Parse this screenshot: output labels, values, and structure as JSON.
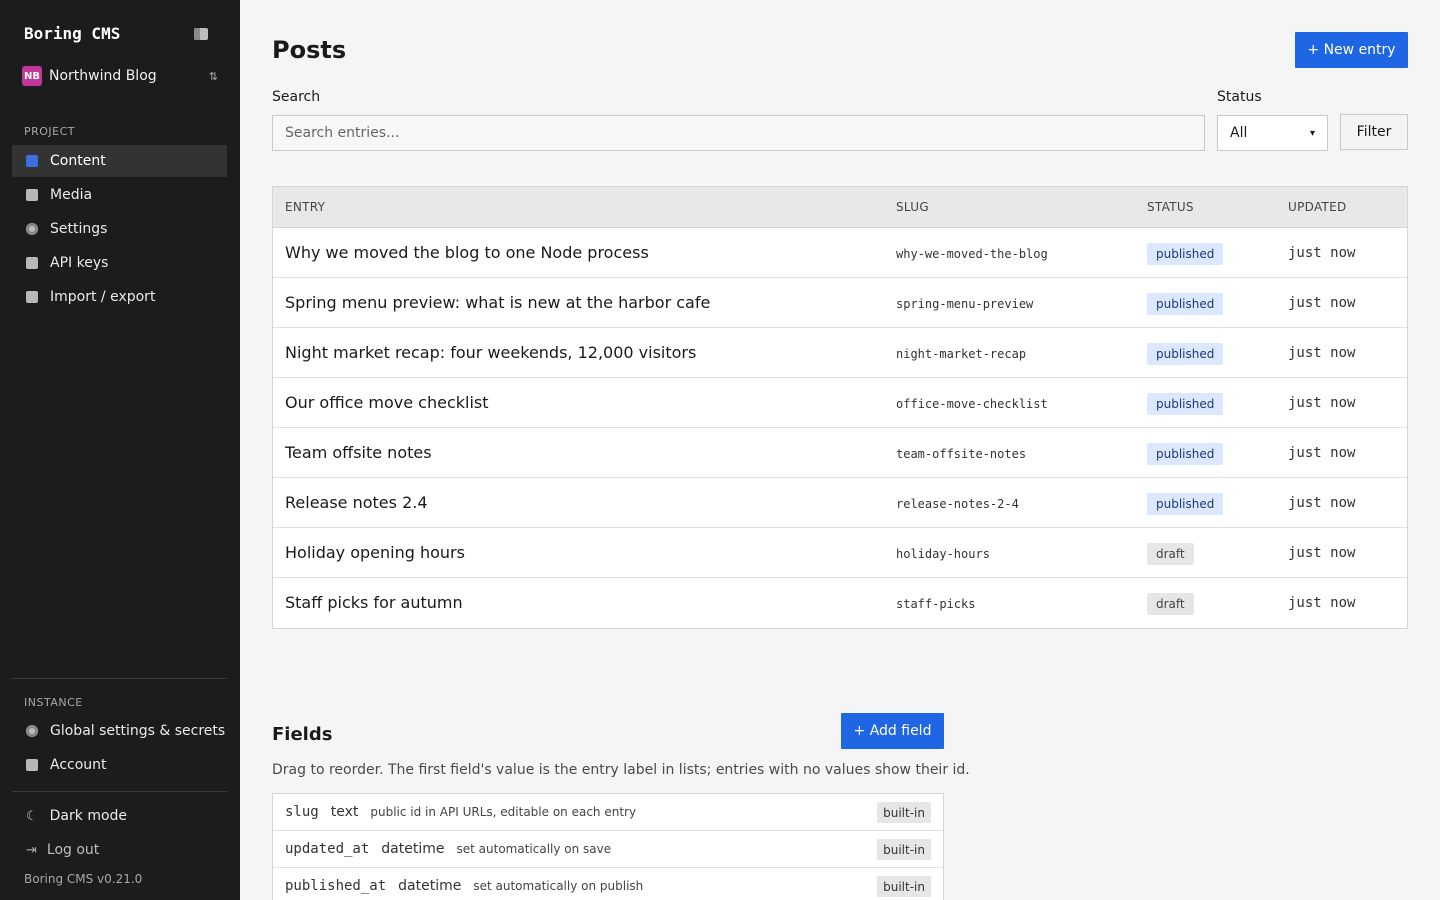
{
  "app": {
    "brand": "Boring CMS",
    "project_initials": "NB",
    "project_name": "Northwind Blog",
    "version": "Boring CMS v0.21.0"
  },
  "sidebar": {
    "project_label": "PROJECT",
    "project_items": [
      {
        "label": "Content",
        "icon": "content-icon",
        "active": true
      },
      {
        "label": "Media",
        "icon": "image-icon"
      },
      {
        "label": "Settings",
        "icon": "gear-icon"
      },
      {
        "label": "API keys",
        "icon": "key-icon"
      },
      {
        "label": "Import / export",
        "icon": "transfer-icon"
      }
    ],
    "instance_label": "INSTANCE",
    "instance_items": [
      {
        "label": "Global settings & secrets",
        "icon": "gear-icon"
      },
      {
        "label": "Account",
        "icon": "id-card-icon"
      }
    ],
    "dark_mode": "Dark mode",
    "logout": "Log out"
  },
  "main": {
    "title": "Posts",
    "new_entry": "+ New entry",
    "search_label": "Search",
    "search_placeholder": "Search entries...",
    "status_label": "Status",
    "status_value": "All",
    "filter": "Filter"
  },
  "table": {
    "headers": [
      "ENTRY",
      "SLUG",
      "STATUS",
      "UPDATED"
    ],
    "rows": [
      {
        "title": "Why we moved the blog to one Node process",
        "slug": "why-we-moved-the-blog",
        "status": "published",
        "updated": "just now"
      },
      {
        "title": "Spring menu preview: what is new at the harbor cafe",
        "slug": "spring-menu-preview",
        "status": "published",
        "updated": "just now"
      },
      {
        "title": "Night market recap: four weekends, 12,000 visitors",
        "slug": "night-market-recap",
        "status": "published",
        "updated": "just now"
      },
      {
        "title": "Our office move checklist",
        "slug": "office-move-checklist",
        "status": "published",
        "updated": "just now"
      },
      {
        "title": "Team offsite notes",
        "slug": "team-offsite-notes",
        "status": "published",
        "updated": "just now"
      },
      {
        "title": "Release notes 2.4",
        "slug": "release-notes-2-4",
        "status": "published",
        "updated": "just now"
      },
      {
        "title": "Holiday opening hours",
        "slug": "holiday-hours",
        "status": "draft",
        "updated": "just now"
      },
      {
        "title": "Staff picks for autumn",
        "slug": "staff-picks",
        "status": "draft",
        "updated": "just now"
      }
    ]
  },
  "fields": {
    "title": "Fields",
    "add_field": "+ Add field",
    "description": "Drag to reorder. The first field's value is the entry label in lists; entries with no values show their id.",
    "items": [
      {
        "name": "slug",
        "type": "text",
        "desc": "public id in API URLs, editable on each entry",
        "badge": "built-in"
      },
      {
        "name": "updated_at",
        "type": "datetime",
        "desc": "set automatically on save",
        "badge": "built-in"
      },
      {
        "name": "published_at",
        "type": "datetime",
        "desc": "set automatically on publish",
        "badge": "built-in"
      }
    ]
  },
  "colors": {
    "sidebar_bg": "#1c1c1c",
    "primary": "#1f66e5",
    "published_badge": "#dbe8ff",
    "draft_badge": "#e6e6e6"
  }
}
